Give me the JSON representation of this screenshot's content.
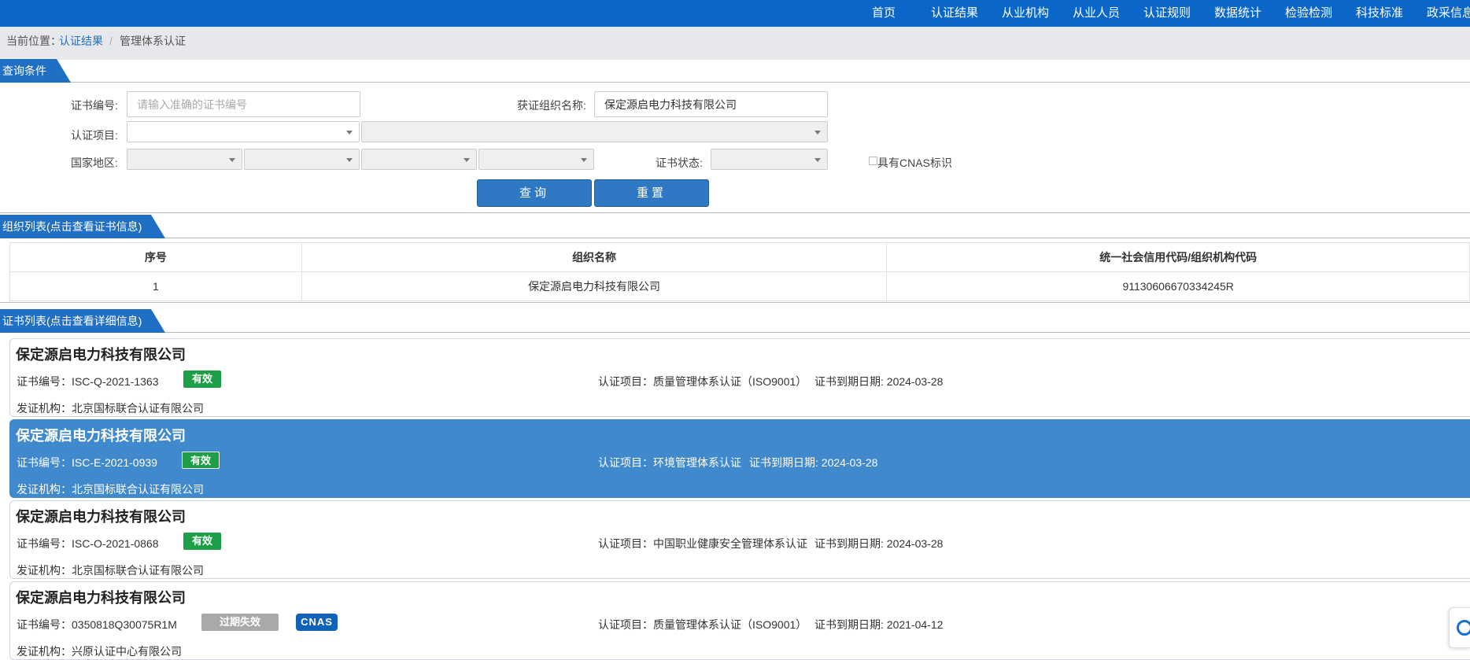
{
  "nav": {
    "items": [
      "首页",
      "认证结果",
      "从业机构",
      "从业人员",
      "认证规则",
      "数据统计",
      "检验检测",
      "科技标准",
      "政采信息"
    ]
  },
  "breadcrumb": {
    "prefix": "当前位置：",
    "link": "认证结果",
    "separator": "/",
    "current": "管理体系认证"
  },
  "query": {
    "section_title": "查询条件",
    "cert_no_label": "证书编号:",
    "cert_no_placeholder": "请输入准确的证书编号",
    "org_name_label": "获证组织名称:",
    "org_name_value": "保定源启电力科技有限公司",
    "project_label": "认证项目:",
    "region_label": "国家地区:",
    "status_label": "证书状态:",
    "cnas_label": "具有CNAS标识",
    "search_button": "查询",
    "reset_button": "重置"
  },
  "org_list": {
    "section_title": "组织列表(点击查看证书信息)",
    "headers": [
      "序号",
      "组织名称",
      "统一社会信用代码/组织机构代码"
    ],
    "rows": [
      [
        "1",
        "保定源启电力科技有限公司",
        "91130606670334245R"
      ]
    ]
  },
  "cert_list": {
    "section_title": "证书列表(点击查看详细信息)",
    "cert_no_prefix": "证书编号：",
    "issuer_prefix": "发证机构：",
    "project_prefix": "认证项目：",
    "expiry_prefix": "证书到期日期: ",
    "cards": [
      {
        "org": "保定源启电力科技有限公司",
        "cert_no": "ISC-Q-2021-1363",
        "status": "有效",
        "issuer": "北京国标联合认证有限公司",
        "project": "质量管理体系认证（ISO9001）",
        "expiry": "2024-03-28"
      },
      {
        "org": "保定源启电力科技有限公司",
        "cert_no": "ISC-E-2021-0939",
        "status": "有效",
        "issuer": "北京国标联合认证有限公司",
        "project": "环境管理体系认证",
        "expiry": "2024-03-28"
      },
      {
        "org": "保定源启电力科技有限公司",
        "cert_no": "ISC-O-2021-0868",
        "status": "有效",
        "issuer": "北京国标联合认证有限公司",
        "project": "中国职业健康安全管理体系认证",
        "expiry": "2024-03-28"
      },
      {
        "org": "保定源启电力科技有限公司",
        "cert_no": "0350818Q30075R1M",
        "status": "过期失效",
        "cnas": "CNAS",
        "issuer": "兴原认证中心有限公司",
        "project": "质量管理体系认证（ISO9001）",
        "expiry": "2021-04-12"
      }
    ]
  },
  "colors": {
    "nav_bg": "#0a67c8",
    "section_tab": "#1f6fc4",
    "selected_card": "#3f89cc",
    "valid_badge": "#1e9e46",
    "expired_badge": "#a9a9a9",
    "cnas_badge": "#1063b8"
  }
}
